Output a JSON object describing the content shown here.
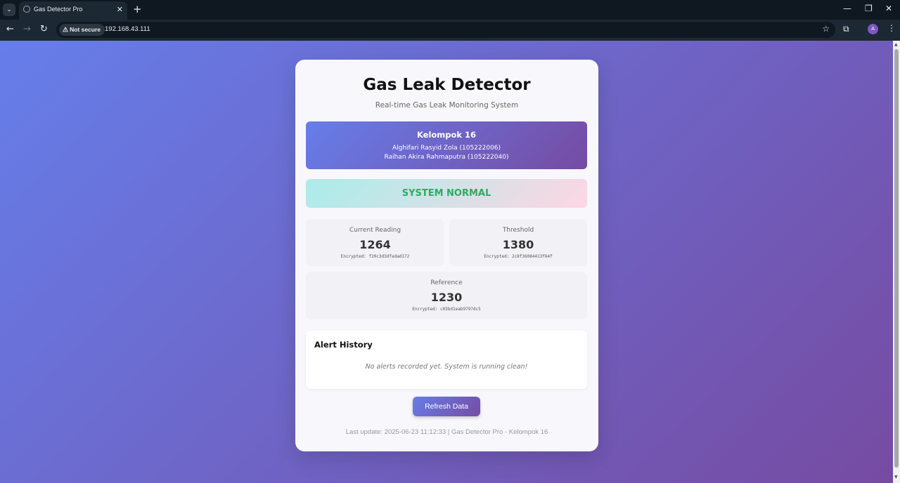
{
  "browser": {
    "tab_title": "Gas Detector Pro",
    "security_label": "Not secure",
    "url": "192.168.43.111",
    "profile_initial": "A"
  },
  "app": {
    "title": "Gas Leak Detector",
    "subtitle": "Real-time Gas Leak Monitoring System",
    "group": {
      "name": "Kelompok 16",
      "members": [
        "Alghifari Rasyid Zola (105222006)",
        "Raihan Akira Rahmaputra (105222040)"
      ]
    },
    "status": {
      "text": "SYSTEM NORMAL",
      "color": "#27ae60"
    },
    "metrics": {
      "current": {
        "label": "Current Reading",
        "value": "1264",
        "encrypted": "Encrypted: f20c3d3dfadad172"
      },
      "threshold": {
        "label": "Threshold",
        "value": "1380",
        "encrypted": "Encrypted: 2c8f36084413f64f"
      },
      "reference": {
        "label": "Reference",
        "value": "1230",
        "encrypted": "Encrypted: c03bd1eab9797dc5"
      }
    },
    "alert_history": {
      "title": "Alert History",
      "empty_message": "No alerts recorded yet. System is running clean!"
    },
    "refresh_label": "Refresh Data",
    "footer": "Last update: 2025-06-23 11:12:33 | Gas Detector Pro - Kelompok 16",
    "accent_gradient": [
      "#667eea",
      "#764ba2"
    ]
  }
}
